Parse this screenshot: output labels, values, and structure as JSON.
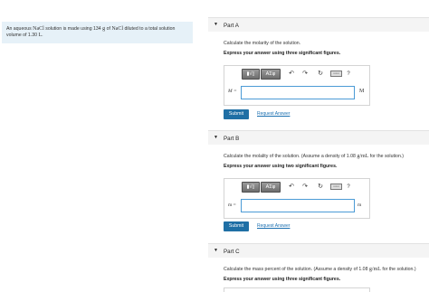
{
  "problem": {
    "line1_pre": "An aqueous ",
    "formula1": "NaCl",
    "line1_mid": " solution is made using 134 ",
    "unit_g": "g",
    "line1_mid2": " of ",
    "formula2": "NaCl",
    "line1_post": " diluted to a total solution",
    "line2_pre": "volume of 1.30 ",
    "unit_L": "L",
    "line2_post": "."
  },
  "partA": {
    "title": "Part A",
    "question": "Calculate the molarity of the solution.",
    "instruction": "Express your answer using three significant figures.",
    "var_label": "M =",
    "unit": "M",
    "submit": "Submit",
    "request": "Request Answer"
  },
  "partB": {
    "title": "Part B",
    "question_pre": "Calculate the molality of the solution. (Assume a density of 1.08 ",
    "density_unit": "g/mL",
    "question_post": " for the solution.)",
    "instruction": "Express your answer using two significant figures.",
    "var_label": "m =",
    "unit": "m",
    "submit": "Submit",
    "request": "Request Answer"
  },
  "partC": {
    "title": "Part C",
    "question_pre": "Calculate the mass percent of the solution. (Assume a density of 1.08 ",
    "density_unit": "g/mL",
    "question_post": " for the solution.)",
    "instruction": "Express your answer using three significant figures."
  },
  "toolbar": {
    "template_label": "▮√▯",
    "symbols_label": "ΑΣφ",
    "undo": "↶",
    "redo": "↷",
    "reset": "↻",
    "keyboard": "▭▭",
    "help": "?"
  },
  "caret": "▼"
}
